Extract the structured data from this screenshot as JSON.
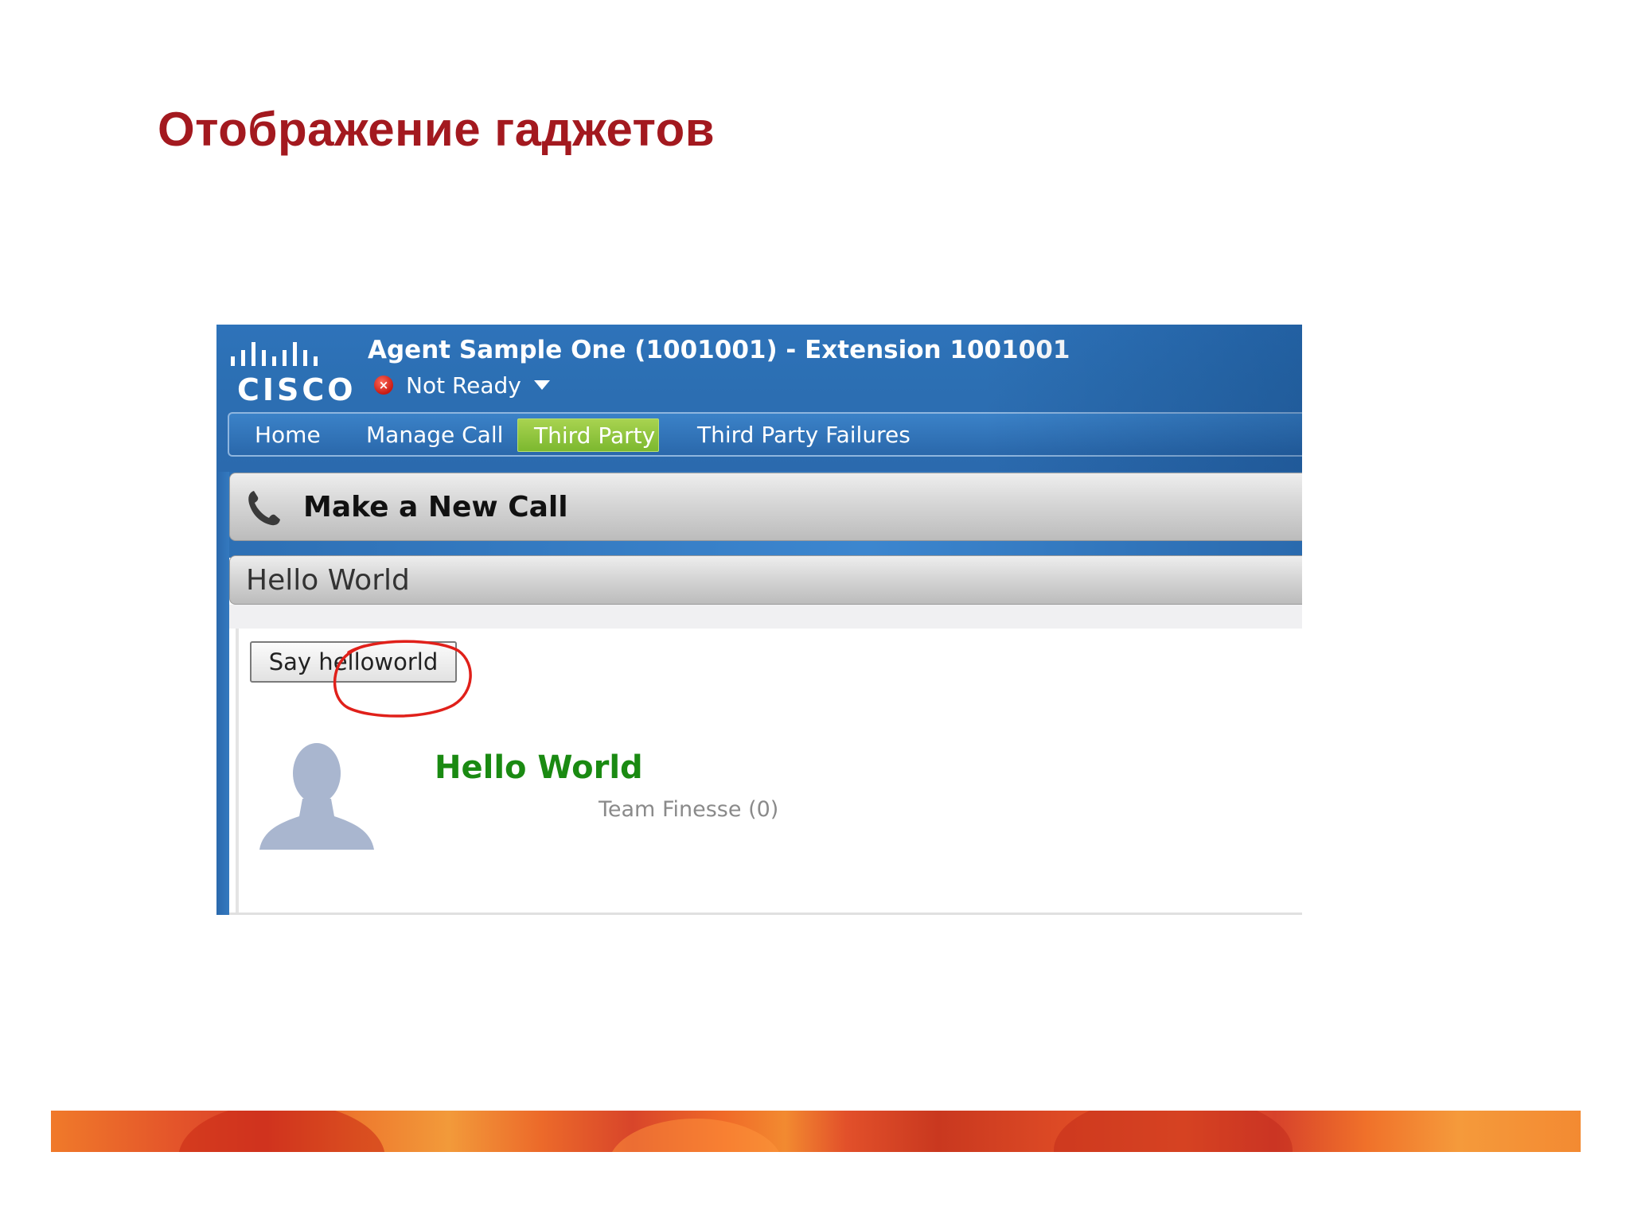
{
  "slide": {
    "title": "Отображение гаджетов"
  },
  "app": {
    "logo_text": "CISCO",
    "agent_title": "Agent Sample One (1001001) - Extension 1001001",
    "status": {
      "label": "Not Ready",
      "icon": "error-x-icon",
      "color": "#c81a12"
    }
  },
  "nav": {
    "tabs": [
      {
        "label": "Home",
        "active": false
      },
      {
        "label": "Manage Call",
        "active": false
      },
      {
        "label": "Third Party",
        "active": true
      },
      {
        "label": "Third Party Failures",
        "active": false
      }
    ]
  },
  "gadgets": {
    "make_call": {
      "title": "Make a New Call",
      "icon": "phone-icon"
    },
    "hello_world": {
      "title": "Hello World",
      "button_label": "Say helloworld",
      "greeting": "Hello World",
      "team_label": "Team Finesse (0)",
      "avatar": "user-silhouette-icon"
    }
  },
  "colors": {
    "title_red": "#a3191f",
    "header_blue": "#2c6fb3",
    "active_tab_green": "#8cc63f",
    "greeting_green": "#1a8a12",
    "annotation_red": "#e0201a"
  }
}
